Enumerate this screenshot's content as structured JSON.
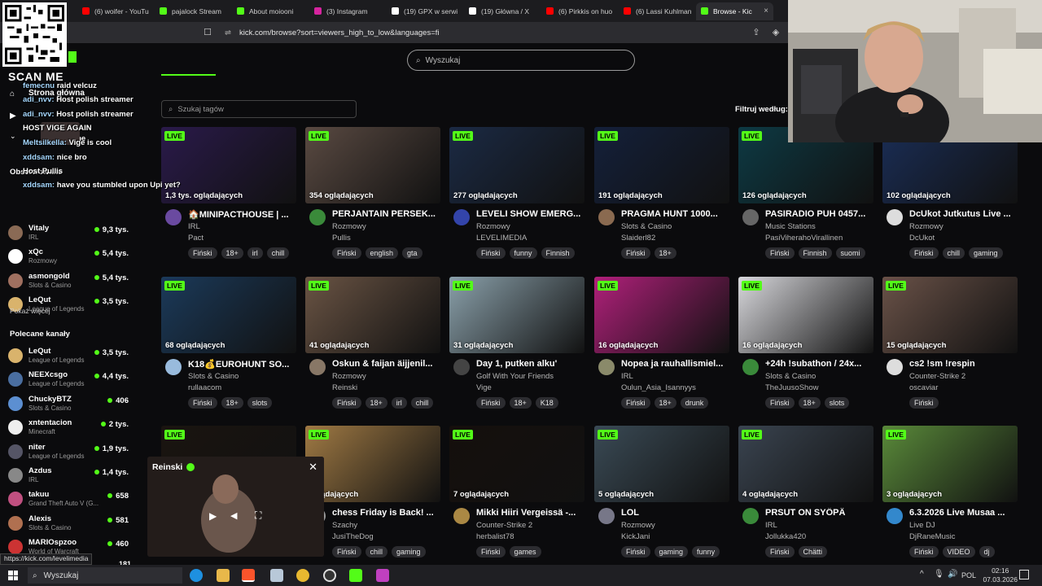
{
  "browser": {
    "tabs": [
      {
        "label": "(6) woifer - YouTu",
        "color": "#ff0000"
      },
      {
        "label": "pajalock Stream",
        "color": "#53fc18"
      },
      {
        "label": "About moiooni",
        "color": "#53fc18"
      },
      {
        "label": "(3) Instagram",
        "color": "#d6249f"
      },
      {
        "label": "(19) GPX w serwi",
        "color": "#ffffff"
      },
      {
        "label": "(19) Główna / X",
        "color": "#ffffff"
      },
      {
        "label": "(6) Pirkkis on huo",
        "color": "#ff0000"
      },
      {
        "label": "(6) Lassi Kuhlman",
        "color": "#ff0000"
      },
      {
        "label": "Browse - Kic",
        "color": "#53fc18",
        "active": true
      }
    ],
    "url": "kick.com/browse?sort=viewers_high_to_low&languages=fi",
    "status_url": "https://kick.com/levelimedia"
  },
  "page": {
    "search_placeholder": "Wyszukaj",
    "tag_search_placeholder": "Szukaj tagów",
    "filter_label": "Filtruj według:",
    "show_more": "Pokaż więcej",
    "recommended_heading": "Polecane kanały"
  },
  "sidebar_top": [
    {
      "name": "Vitaly",
      "category": "IRL",
      "viewers": "9,3 tys.",
      "color": "#8a6a55"
    },
    {
      "name": "xQc",
      "category": "Rozmowy",
      "viewers": "5,4 tys.",
      "color": "#ffffff"
    },
    {
      "name": "asmongold",
      "category": "Slots & Casino",
      "viewers": "5,4 tys.",
      "color": "#a07060"
    },
    {
      "name": "LeQut",
      "category": "League of Legends",
      "viewers": "3,5 tys.",
      "color": "#d9b36c"
    }
  ],
  "sidebar_recommended": [
    {
      "name": "LeQut",
      "category": "League of Legends",
      "viewers": "3,5 tys.",
      "color": "#d9b36c"
    },
    {
      "name": "NEEXcsgo",
      "category": "League of Legends",
      "viewers": "4,4 tys.",
      "color": "#4a6ea0"
    },
    {
      "name": "ChuckyBTZ",
      "category": "Slots & Casino",
      "viewers": "406",
      "color": "#5c8fd1"
    },
    {
      "name": "xntentacion",
      "category": "Minecraft",
      "viewers": "2 tys.",
      "color": "#eeeeee"
    },
    {
      "name": "niter",
      "category": "League of Legends",
      "viewers": "1,9 tys.",
      "color": "#555566"
    },
    {
      "name": "Azdus",
      "category": "IRL",
      "viewers": "1,4 tys.",
      "color": "#888888"
    },
    {
      "name": "takuu",
      "category": "Grand Theft Auto V (G...",
      "viewers": "658",
      "color": "#c05080"
    },
    {
      "name": "Alexis",
      "category": "Slots & Casino",
      "viewers": "581",
      "color": "#b07050"
    },
    {
      "name": "MARIOspzoo",
      "category": "World of Warcraft",
      "viewers": "460",
      "color": "#cc3333"
    }
  ],
  "sidebar_partial_viewers": "181",
  "chat_overlay": {
    "scan_me": "SCAN ME",
    "lines": [
      {
        "user": "femecnu",
        "text": "raid velcuz"
      },
      {
        "user": "adi_nvv:",
        "text": "Host   polish streamer"
      },
      {
        "user": "adi_nvv:",
        "text": "Host   polish streamer"
      },
      {
        "user": "",
        "text": "HOST VIGE AGAIN"
      },
      {
        "user": "Meltsilkella:",
        "text": "Vige is cool"
      },
      {
        "user": "xddsam:",
        "text": "nice bro"
      },
      {
        "user": "",
        "text": "Host Pullis"
      },
      {
        "user": "xddsam:",
        "text": "have you stumbled upon Upi yet?"
      }
    ],
    "sidebar_labels": {
      "home": "Strona główna",
      "followed": "Obserwowane",
      "followed_short": "Vowane",
      "following_head": "Obserwowane kanały"
    }
  },
  "streams": [
    {
      "viewers": "1,3 tys. oglądających",
      "title": "🏠MINIPACTHOUSE | ...",
      "category": "IRL",
      "streamer": "Pact",
      "tags": [
        "Fiński",
        "18+",
        "irl",
        "chill"
      ],
      "thumb": "#2a1a4a",
      "av": "#6a4aa0"
    },
    {
      "viewers": "354 oglądających",
      "title": "PERJANTAIN PERSEK...",
      "category": "Rozmowy",
      "streamer": "Pullis",
      "tags": [
        "Fiński",
        "english",
        "gta"
      ],
      "thumb": "#5a4a42",
      "av": "#3a8a3a"
    },
    {
      "viewers": "277 oglądających",
      "title": "LEVELI SHOW EMERG...",
      "category": "Rozmowy",
      "streamer": "LEVELIMEDIA",
      "tags": [
        "Fiński",
        "funny",
        "Finnish"
      ],
      "thumb": "#1b2a44",
      "av": "#3344aa"
    },
    {
      "viewers": "191 oglądających",
      "title": "PRAGMA HUNT 1000...",
      "category": "Slots & Casino",
      "streamer": "Slaiderl82",
      "tags": [
        "Fiński",
        "18+"
      ],
      "thumb": "#14203a",
      "av": "#8a6a50"
    },
    {
      "viewers": "126 oglądających",
      "title": "PASIRADIO PUH 0457...",
      "category": "Music Stations",
      "streamer": "PasiViherahoVirallinen",
      "tags": [
        "Fiński",
        "Finnish",
        "suomi"
      ],
      "thumb": "#0d3a44",
      "av": "#666666"
    },
    {
      "viewers": "102 oglądających",
      "title": "DcUkot Jutkutus Live ...",
      "category": "Rozmowy",
      "streamer": "DcUkot",
      "tags": [
        "Fiński",
        "chill",
        "gaming"
      ],
      "thumb": "#1a2d55",
      "av": "#dddddd"
    },
    {
      "viewers": "68 oglądających",
      "title": "K18💰EUROHUNT SO...",
      "category": "Slots & Casino",
      "streamer": "rullaacom",
      "tags": [
        "Fiński",
        "18+",
        "slots"
      ],
      "thumb": "#1b3a5a",
      "av": "#99bbdd"
    },
    {
      "viewers": "41 oglądających",
      "title": "Oskun & faijan äijjenil...",
      "category": "Rozmowy",
      "streamer": "Reinski",
      "tags": [
        "Fiński",
        "18+",
        "irl",
        "chill"
      ],
      "thumb": "#6a5444",
      "av": "#887766"
    },
    {
      "viewers": "31 oglądających",
      "title": "Day 1, putken alku'",
      "category": "Golf With Your Friends",
      "streamer": "Vige",
      "tags": [
        "Fiński",
        "18+",
        "K18"
      ],
      "thumb": "#8aa0aa",
      "av": "#444444"
    },
    {
      "viewers": "16 oglądających",
      "title": "Nopea ja rauhallismiel...",
      "category": "IRL",
      "streamer": "Oulun_Asia_Isannyys",
      "tags": [
        "Fiński",
        "18+",
        "drunk"
      ],
      "thumb": "#b0207a",
      "av": "#8a8a6a"
    },
    {
      "viewers": "16 oglądających",
      "title": "+24h !subathon / 24x...",
      "category": "Slots & Casino",
      "streamer": "TheJuusoShow",
      "tags": [
        "Fiński",
        "18+",
        "slots"
      ],
      "thumb": "#d8d8dc",
      "av": "#3a8a3a"
    },
    {
      "viewers": "15 oglądających",
      "title": "cs2 !sm !respin",
      "category": "Counter-Strike 2",
      "streamer": "oscaviar",
      "tags": [
        "Fiński"
      ],
      "thumb": "#6a5248",
      "av": "#dddddd"
    },
    {
      "viewers": "",
      "title": "",
      "category": "",
      "streamer": "",
      "tags": [],
      "thumb": "#1a1410",
      "av": "#333333"
    },
    {
      "viewers": "oglądających",
      "title": "chess Friday is Back! ...",
      "category": "Szachy",
      "streamer": "JusiTheDog",
      "tags": [
        "Fiński",
        "chill",
        "gaming"
      ],
      "thumb": "#a07a44",
      "av": "#999999"
    },
    {
      "viewers": "7 oglądających",
      "title": "Mikki Hiiri Vergeissä -...",
      "category": "Counter-Strike 2",
      "streamer": "herbalist78",
      "tags": [
        "Fiński",
        "games"
      ],
      "thumb": "#150f0c",
      "av": "#aa8844"
    },
    {
      "viewers": "5 oglądających",
      "title": "LOL",
      "category": "Rozmowy",
      "streamer": "KickJani",
      "tags": [
        "Fiński",
        "gaming",
        "funny"
      ],
      "thumb": "#3a4a55",
      "av": "#777788"
    },
    {
      "viewers": "4 oglądających",
      "title": "PRSUT ON SYÖPÄ",
      "category": "IRL",
      "streamer": "Jollukka420",
      "tags": [
        "Fiński",
        "Chätti"
      ],
      "thumb": "#3a4450",
      "av": "#3a8a3a"
    },
    {
      "viewers": "3 oglądających",
      "title": "6.3.2026 Live Musaa ...",
      "category": "Live DJ",
      "streamer": "DjRaneMusic",
      "tags": [
        "Fiński",
        "VIDEO",
        "dj"
      ],
      "thumb": "#5a8a3a",
      "av": "#3388cc"
    }
  ],
  "mini_player": {
    "title": "Reinski"
  },
  "taskbar": {
    "search": "Wyszukaj",
    "lang": "POL",
    "time": "02:16",
    "date": "07.03.2026"
  }
}
